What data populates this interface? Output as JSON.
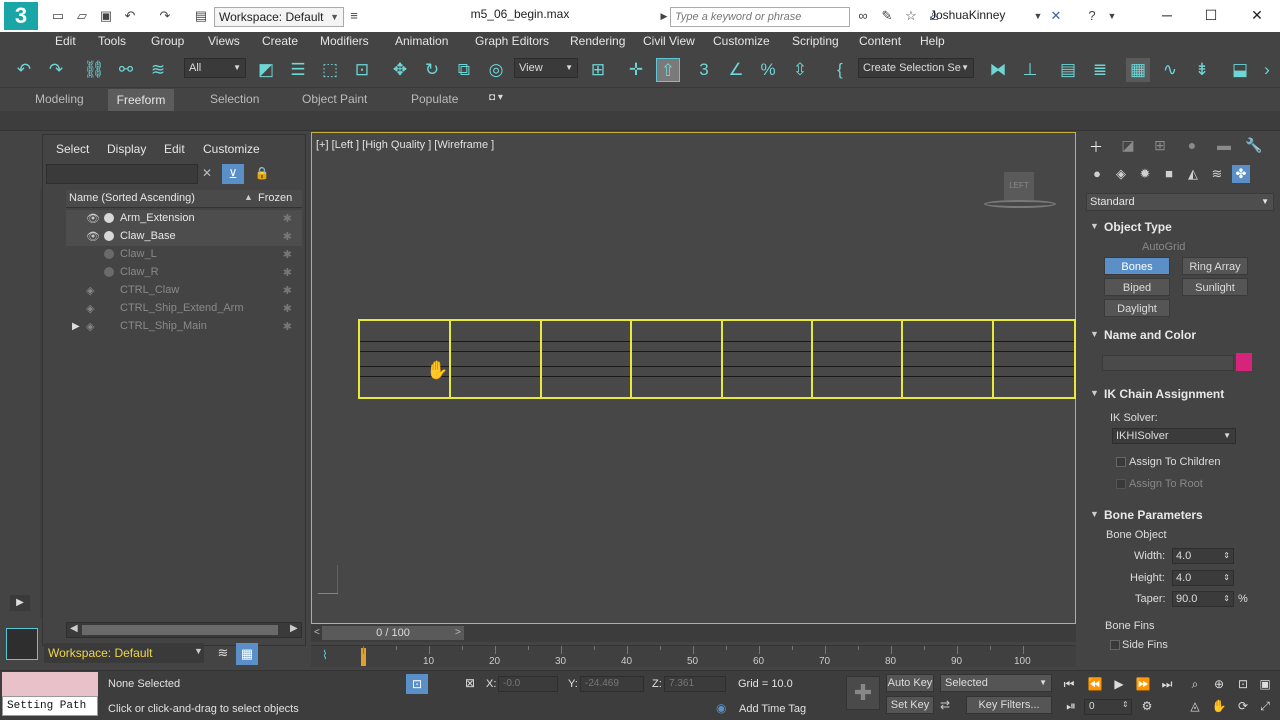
{
  "titlebar": {
    "logo": "3",
    "workspace": "Workspace: Default",
    "document": "m5_06_begin.max",
    "search_placeholder": "Type a keyword or phrase",
    "user": "JoshuaKinney"
  },
  "menu": [
    "Edit",
    "Tools",
    "Group",
    "Views",
    "Create",
    "Modifiers",
    "Animation",
    "Graph Editors",
    "Rendering",
    "Civil View",
    "Customize",
    "Scripting",
    "Content",
    "Help"
  ],
  "toolbar": {
    "filter": "All",
    "refcoord": "View",
    "selection_set": "Create Selection Se"
  },
  "ribbon": {
    "tabs": [
      "Modeling",
      "Freeform",
      "Selection",
      "Object Paint",
      "Populate"
    ],
    "active": "Freeform"
  },
  "explorer": {
    "tabs": [
      "Select",
      "Display",
      "Edit",
      "Customize"
    ],
    "column_name": "Name (Sorted Ascending)",
    "column_frozen": "Frozen",
    "rows": [
      {
        "name": "Arm_Extension",
        "state": "on"
      },
      {
        "name": "Claw_Base",
        "state": "on"
      },
      {
        "name": "Claw_L",
        "state": "off"
      },
      {
        "name": "Claw_R",
        "state": "off"
      },
      {
        "name": "CTRL_Claw",
        "state": "off"
      },
      {
        "name": "CTRL_Ship_Extend_Arm",
        "state": "off"
      },
      {
        "name": "CTRL_Ship_Main",
        "state": "off"
      }
    ],
    "workspace": "Workspace: Default"
  },
  "viewport": {
    "label": "[+] [Left ] [High Quality ] [Wireframe ]",
    "cube_label": "LEFT"
  },
  "command_panel": {
    "category": "Standard",
    "object_type": {
      "header": "Object Type",
      "autogrid": "AutoGrid",
      "buttons": [
        "Bones",
        "Ring Array",
        "Biped",
        "Sunlight",
        "Daylight"
      ],
      "active": "Bones"
    },
    "name_color": {
      "header": "Name and Color",
      "swatch": "#d6247a"
    },
    "ik": {
      "header": "IK Chain Assignment",
      "solver_label": "IK Solver:",
      "solver": "IKHISolver",
      "assign_children": "Assign To Children",
      "assign_root": "Assign To Root"
    },
    "bone_params": {
      "header": "Bone Parameters",
      "group": "Bone Object",
      "width_label": "Width:",
      "width": "4.0",
      "height_label": "Height:",
      "height": "4.0",
      "taper_label": "Taper:",
      "taper": "90.0",
      "taper_unit": "%",
      "fins": "Bone Fins",
      "side_fins": "Side Fins"
    }
  },
  "timeline": {
    "frame": "0 / 100",
    "ticks": [
      "10",
      "20",
      "30",
      "40",
      "50",
      "60",
      "70",
      "80",
      "90",
      "100"
    ]
  },
  "status": {
    "set_path": "Setting Path",
    "selection": "None Selected",
    "prompt": "Click or click-and-drag to select objects",
    "x_label": "X:",
    "x": "-0.0",
    "y_label": "Y:",
    "y": "-24.469",
    "z_label": "Z:",
    "z": "7.361",
    "grid": "Grid = 10.0",
    "add_time_tag": "Add Time Tag",
    "auto_key": "Auto Key",
    "key_mode": "Selected",
    "set_key": "Set Key",
    "key_filters": "Key Filters...",
    "current_frame": "0"
  },
  "colors": {
    "accent": "#5cc7d6",
    "selection": "#e9e93a",
    "active_button": "#5b8fc8",
    "workspace_text": "#f0d64a"
  }
}
